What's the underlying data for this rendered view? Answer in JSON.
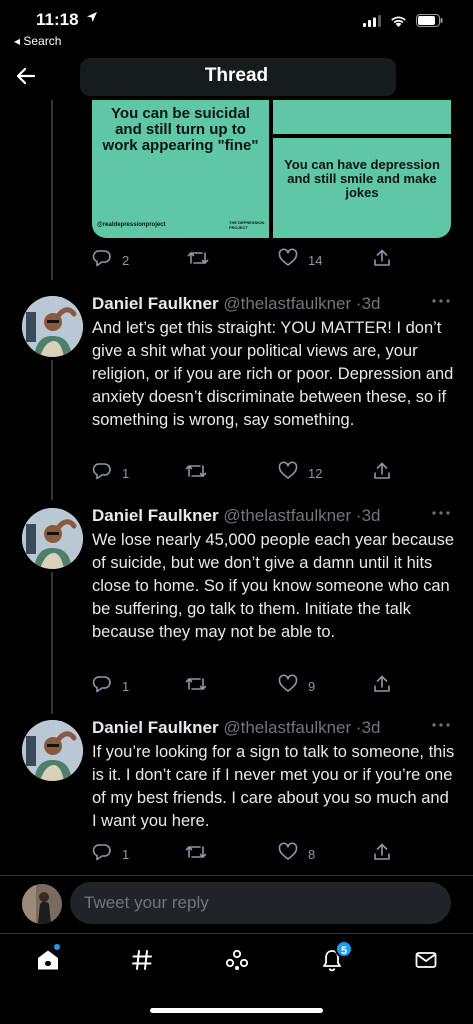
{
  "status_bar": {
    "time": "11:18",
    "back_label": "◂ Search"
  },
  "header": {
    "title": "Thread"
  },
  "media": {
    "tile1_text": "You can be suicidal and still turn up to work appearing \"fine\"",
    "tile1_handle": "@realdepressionproject",
    "tile1_logo": "THE DEPRESSION PROJECT",
    "tile3_text": "You can have depression and still smile and make jokes"
  },
  "media_actions": {
    "replies": "2",
    "retweets": "",
    "likes": "14"
  },
  "tweets": [
    {
      "name": "Daniel Faulkner",
      "handle": "@thelastfaulkner",
      "separator": "·",
      "time": "3d",
      "text": "And let’s get this straight: YOU MATTER! I don’t give a shit what your political views are, your religion, or if you are rich or poor. Depression and anxiety doesn’t discriminate between these, so if something is wrong, say something.",
      "replies": "1",
      "retweets": "",
      "likes": "12"
    },
    {
      "name": "Daniel Faulkner",
      "handle": "@thelastfaulkner",
      "separator": "·",
      "time": "3d",
      "text": "We lose nearly 45,000 people each year because of suicide, but we don’t give a damn until it hits close to home. So if you know someone who can be suffering, go talk to them. Initiate the talk because they may not be able to.",
      "replies": "1",
      "retweets": "",
      "likes": "9"
    },
    {
      "name": "Daniel Faulkner",
      "handle": "@thelastfaulkner",
      "separator": "·",
      "time": "3d",
      "text": "If you’re looking for a sign to talk to someone, this is it. I don’t care if I never met you or if you’re one of my best friends. I care about you so much and I want you here.",
      "replies": "1",
      "retweets": "",
      "likes": "8"
    }
  ],
  "reply": {
    "placeholder": "Tweet your reply"
  },
  "tabbar": {
    "notifications_badge": "5"
  },
  "colors": {
    "background": "#000000",
    "accent": "#1d9bf0",
    "media_tile": "#5fc7a8",
    "muted_text": "#71767b"
  }
}
